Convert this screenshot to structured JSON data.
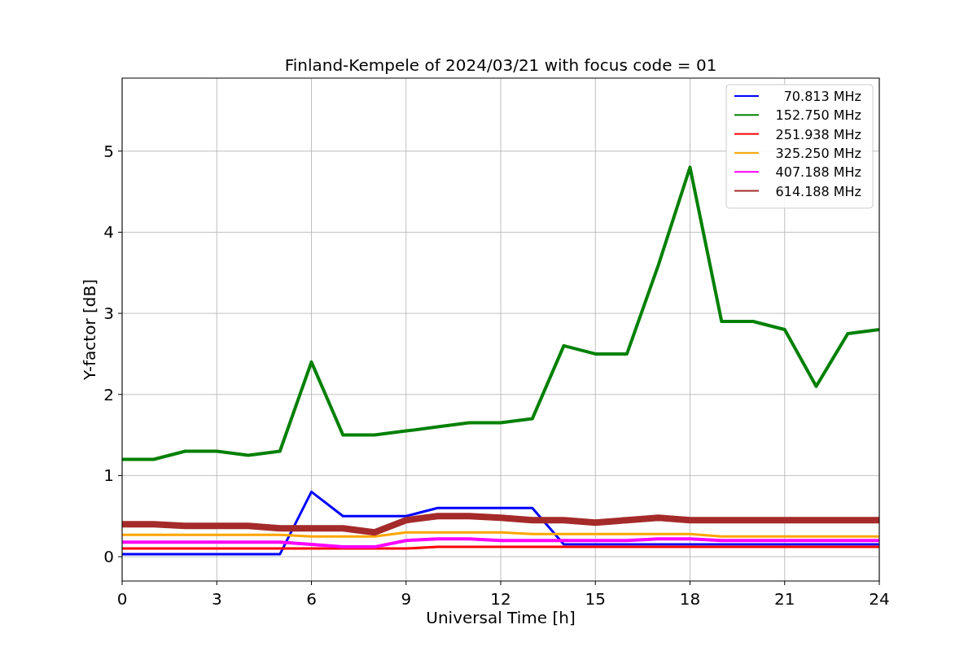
{
  "chart": {
    "chart_data": {
      "type": "line",
      "title": "Finland-Kempele of 2024/03/21 with focus code = 01",
      "xlabel": "Universal Time [h]",
      "ylabel": "Y-factor [dB]",
      "x": [
        0,
        1,
        2,
        3,
        4,
        5,
        6,
        7,
        8,
        9,
        10,
        11,
        12,
        13,
        14,
        15,
        16,
        17,
        18,
        19,
        20,
        21,
        22,
        23,
        24
      ],
      "series": [
        {
          "name": "70.813 MHz",
          "color": "#0000ff",
          "values": [
            0.03,
            0.03,
            0.03,
            0.03,
            0.03,
            0.03,
            0.8,
            0.5,
            0.5,
            0.5,
            0.6,
            0.6,
            0.6,
            0.6,
            0.15,
            0.15,
            0.15,
            0.15,
            0.15,
            0.15,
            0.15,
            0.15,
            0.15,
            0.15,
            0.15
          ]
        },
        {
          "name": "152.750 MHz",
          "color": "#008000",
          "values": [
            1.2,
            1.2,
            1.3,
            1.3,
            1.25,
            1.3,
            2.4,
            1.5,
            1.5,
            1.55,
            1.6,
            1.65,
            1.65,
            1.7,
            2.6,
            2.5,
            2.5,
            3.6,
            4.8,
            2.9,
            2.9,
            2.8,
            2.1,
            2.75,
            2.8
          ]
        },
        {
          "name": "251.938 MHz",
          "color": "#ff0000",
          "values": [
            0.1,
            0.1,
            0.1,
            0.1,
            0.1,
            0.1,
            0.1,
            0.1,
            0.1,
            0.1,
            0.12,
            0.12,
            0.12,
            0.12,
            0.12,
            0.12,
            0.12,
            0.12,
            0.12,
            0.12,
            0.12,
            0.12,
            0.12,
            0.12,
            0.12
          ]
        },
        {
          "name": "325.250 MHz",
          "color": "#ffa500",
          "values": [
            0.27,
            0.27,
            0.27,
            0.27,
            0.27,
            0.27,
            0.25,
            0.25,
            0.25,
            0.3,
            0.3,
            0.3,
            0.3,
            0.28,
            0.28,
            0.28,
            0.28,
            0.28,
            0.28,
            0.25,
            0.25,
            0.25,
            0.25,
            0.25,
            0.25
          ]
        },
        {
          "name": "407.188 MHz",
          "color": "#ff00ff",
          "values": [
            0.18,
            0.18,
            0.18,
            0.18,
            0.18,
            0.18,
            0.15,
            0.12,
            0.12,
            0.2,
            0.22,
            0.22,
            0.2,
            0.2,
            0.2,
            0.2,
            0.2,
            0.22,
            0.22,
            0.2,
            0.2,
            0.2,
            0.2,
            0.2,
            0.2
          ]
        },
        {
          "name": "614.188 MHz",
          "color": "#a52a2a",
          "values": [
            0.4,
            0.4,
            0.38,
            0.38,
            0.38,
            0.35,
            0.35,
            0.35,
            0.3,
            0.45,
            0.5,
            0.5,
            0.48,
            0.45,
            0.45,
            0.42,
            0.45,
            0.48,
            0.45,
            0.45,
            0.45,
            0.45,
            0.45,
            0.45,
            0.45
          ]
        }
      ],
      "grid": true,
      "legend": true,
      "xlim": [
        0,
        24
      ],
      "ylim": [
        -0.3,
        5.9
      ],
      "xticks": [
        0,
        3,
        6,
        9,
        12,
        15,
        18,
        21,
        24
      ],
      "yticks": [
        0,
        1,
        2,
        3,
        4,
        5
      ]
    }
  }
}
